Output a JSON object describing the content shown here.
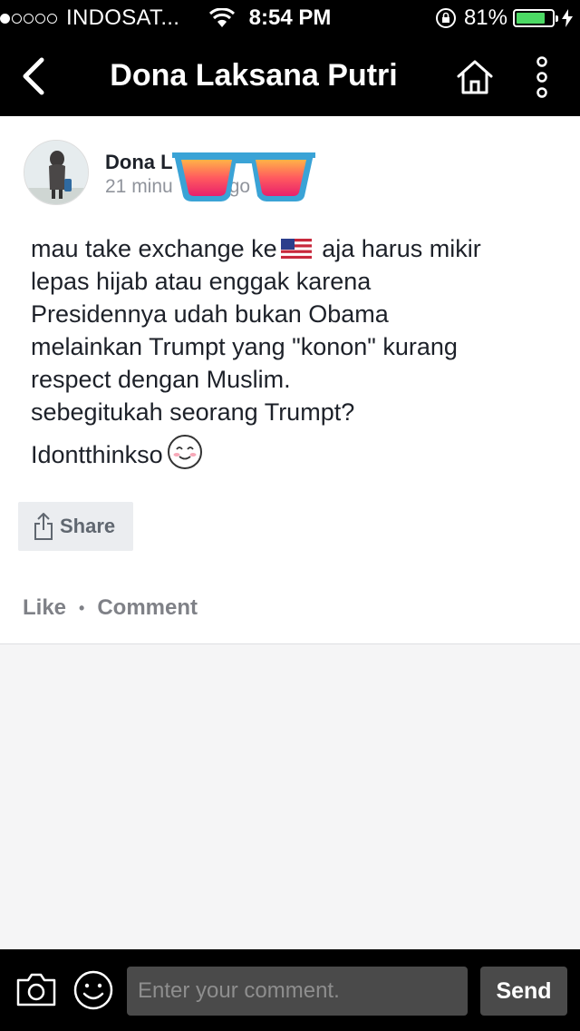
{
  "status_bar": {
    "carrier": "INDOSAT...",
    "time": "8:54 PM",
    "battery_percent": "81%",
    "battery_level": 0.81,
    "signal_bars": 1
  },
  "nav": {
    "title": "Dona Laksana Putri",
    "back_icon": "chevron-left-icon",
    "home_icon": "home-icon",
    "more_icon": "more-vertical-icon"
  },
  "post": {
    "author": "Dona L",
    "time_ago": "21 minu",
    "time_ago_tail": "go",
    "text_line1_a": "mau take exchange ke",
    "text_line1_b": " aja harus mikir",
    "text_rest": "lepas hijab atau enggak karena\nPresidennya udah bukan Obama\nmelainkan Trumpt yang \"konon\" kurang\nrespect dengan Muslim.\nsebegitukah seorang Trumpt?",
    "hashtag": "Idontthinkso",
    "share_label": "Share",
    "like_label": "Like",
    "comment_label": "Comment"
  },
  "composer": {
    "placeholder": "Enter your comment.",
    "send_label": "Send"
  },
  "colors": {
    "bar_bg": "#000000",
    "battery_fill": "#4cd964",
    "muted_text": "#90949c",
    "share_bg": "#ebedf0"
  }
}
